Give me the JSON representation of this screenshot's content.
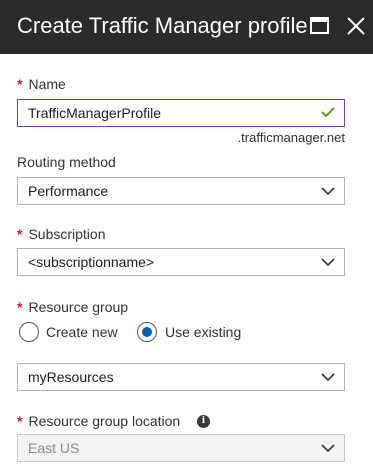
{
  "window": {
    "title": "Create Traffic Manager profile"
  },
  "form": {
    "name": {
      "label": "Name",
      "value": "TrafficManagerProfile",
      "suffix": ".trafficmanager.net",
      "valid": true
    },
    "routing_method": {
      "label": "Routing method",
      "value": "Performance"
    },
    "subscription": {
      "label": "Subscription",
      "value": "<subscriptionname>"
    },
    "resource_group": {
      "label": "Resource group",
      "options": [
        "Create new",
        "Use existing"
      ],
      "selected": "Use existing",
      "value": "myResources"
    },
    "resource_group_location": {
      "label": "Resource group location",
      "value": "East US",
      "disabled": true
    },
    "required_marker": "*"
  },
  "colors": {
    "titlebar_bg": "#2b2b2b",
    "required": "#c8202a",
    "focus_border": "#8a35a8",
    "valid_check": "#5c9e1e",
    "radio_selected": "#0060b8"
  },
  "icons": {
    "maximize": "maximize-icon",
    "close": "close-icon",
    "chevron": "chevron-down-icon",
    "check": "checkmark-icon",
    "info": "info-icon"
  }
}
